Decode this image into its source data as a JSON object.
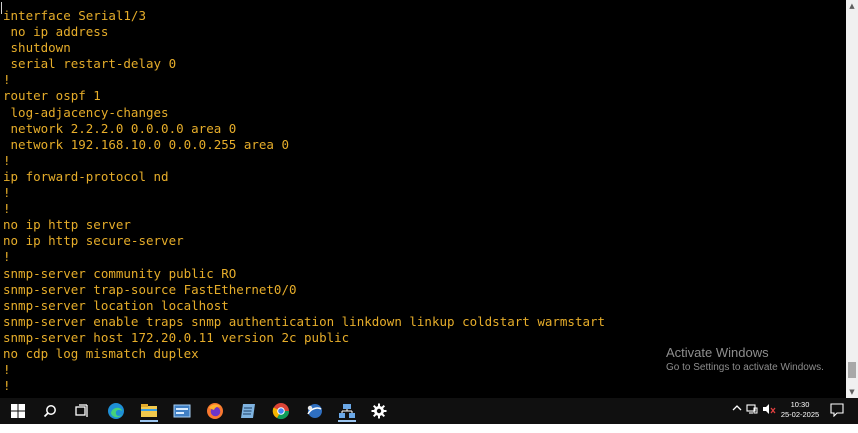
{
  "terminal": {
    "lines": [
      "interface Serial1/3",
      " no ip address",
      " shutdown",
      " serial restart-delay 0",
      "!",
      "router ospf 1",
      " log-adjacency-changes",
      " network 2.2.2.0 0.0.0.0 area 0",
      " network 192.168.10.0 0.0.0.255 area 0",
      "!",
      "ip forward-protocol nd",
      "!",
      "!",
      "no ip http server",
      "no ip http secure-server",
      "!",
      "snmp-server community public RO",
      "snmp-server trap-source FastEthernet0/0",
      "snmp-server location localhost",
      "snmp-server enable traps snmp authentication linkdown linkup coldstart warmstart",
      "snmp-server host 172.20.0.11 version 2c public",
      "no cdp log mismatch duplex",
      "!",
      "!"
    ],
    "text_color": "#e6ad2a",
    "background_color": "#000000"
  },
  "watermark": {
    "title": "Activate Windows",
    "subtitle": "Go to Settings to activate Windows."
  },
  "taskbar": {
    "icons": [
      {
        "name": "windows-start-icon"
      },
      {
        "name": "search-icon"
      },
      {
        "name": "task-view-icon"
      },
      {
        "name": "edge-browser-icon"
      },
      {
        "name": "file-explorer-icon"
      },
      {
        "name": "terminal-app-icon"
      },
      {
        "name": "firefox-icon"
      },
      {
        "name": "notepad-app-icon"
      },
      {
        "name": "chrome-icon"
      },
      {
        "name": "app-globe-icon"
      },
      {
        "name": "network-app-icon"
      },
      {
        "name": "settings-gear-icon"
      }
    ],
    "clock": {
      "time": "10:30",
      "date": "25-02-2025"
    }
  }
}
